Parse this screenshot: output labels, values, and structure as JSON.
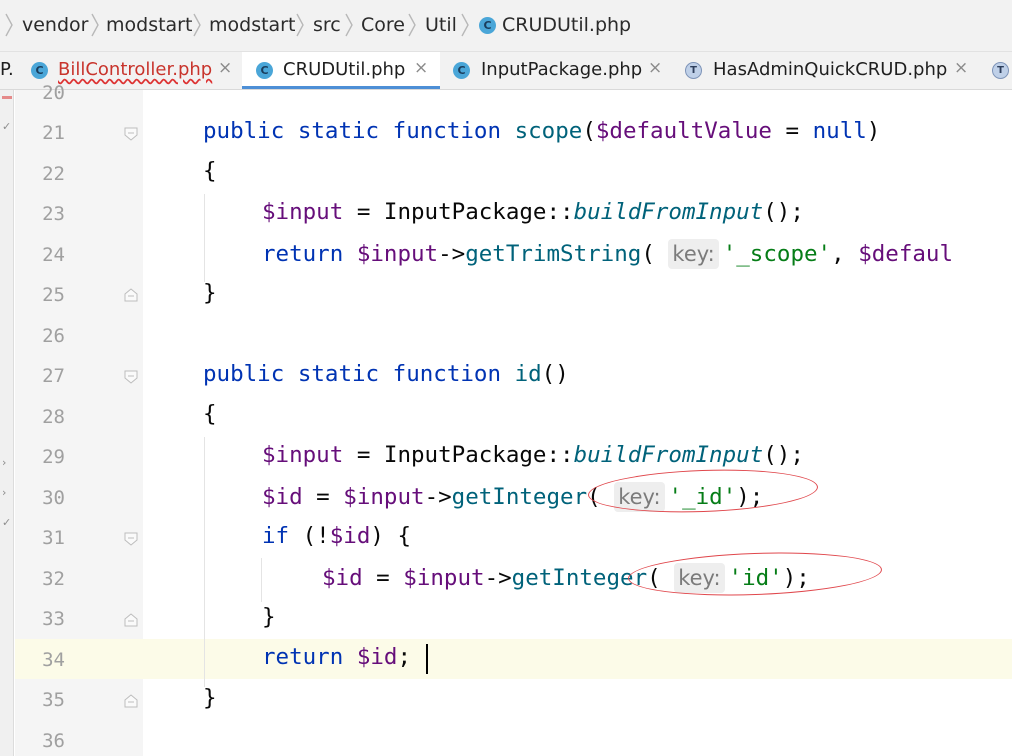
{
  "breadcrumb": {
    "items": [
      "vendor",
      "modstart",
      "modstart",
      "src",
      "Core",
      "Util"
    ],
    "file": "CRUDUtil.php"
  },
  "tabs": {
    "cut_label": "P.",
    "items": [
      {
        "label": "BillController.php",
        "icon": "class-icon",
        "close": "×"
      },
      {
        "label": "CRUDUtil.php",
        "icon": "class-icon",
        "close": "×"
      },
      {
        "label": "InputPackage.php",
        "icon": "class-icon",
        "close": "×"
      },
      {
        "label": "HasAdminQuickCRUD.php",
        "icon": "trait-icon",
        "close": "×"
      }
    ]
  },
  "editor": {
    "line_numbers": [
      "20",
      "21",
      "22",
      "23",
      "24",
      "25",
      "26",
      "27",
      "28",
      "29",
      "30",
      "31",
      "32",
      "33",
      "34",
      "35",
      "36"
    ],
    "tokens": {
      "public": "public",
      "static": "static",
      "function": "function",
      "return": "return",
      "if": "if",
      "null": "null",
      "scope": "scope",
      "id": "id",
      "default_param": "$defaultValue",
      "input_var": "$input",
      "id_var": "$id",
      "input_package": "InputPackage",
      "build_from_input": "buildFromInput",
      "get_trim_string": "getTrimString",
      "get_integer": "getInteger",
      "key_hint": "key:",
      "scope_key": "'_scope'",
      "id_key_underscore": "'_id'",
      "id_key": "'id'",
      "truncated_default": "$defaul"
    }
  },
  "colors": {
    "keyword": "#0033b3",
    "function": "#00627a",
    "variable": "#660e7a",
    "string": "#067d17",
    "annotation": "#e0474c",
    "active_tab": "#4d8fd6"
  }
}
